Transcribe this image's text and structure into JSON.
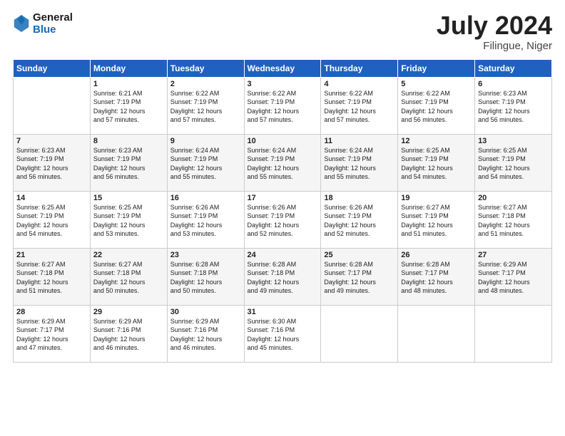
{
  "header": {
    "logo_line1": "General",
    "logo_line2": "Blue",
    "month_title": "July 2024",
    "location": "Filingue, Niger"
  },
  "days_of_week": [
    "Sunday",
    "Monday",
    "Tuesday",
    "Wednesday",
    "Thursday",
    "Friday",
    "Saturday"
  ],
  "weeks": [
    [
      {
        "day": "",
        "info": ""
      },
      {
        "day": "1",
        "info": "Sunrise: 6:21 AM\nSunset: 7:19 PM\nDaylight: 12 hours\nand 57 minutes."
      },
      {
        "day": "2",
        "info": "Sunrise: 6:22 AM\nSunset: 7:19 PM\nDaylight: 12 hours\nand 57 minutes."
      },
      {
        "day": "3",
        "info": "Sunrise: 6:22 AM\nSunset: 7:19 PM\nDaylight: 12 hours\nand 57 minutes."
      },
      {
        "day": "4",
        "info": "Sunrise: 6:22 AM\nSunset: 7:19 PM\nDaylight: 12 hours\nand 57 minutes."
      },
      {
        "day": "5",
        "info": "Sunrise: 6:22 AM\nSunset: 7:19 PM\nDaylight: 12 hours\nand 56 minutes."
      },
      {
        "day": "6",
        "info": "Sunrise: 6:23 AM\nSunset: 7:19 PM\nDaylight: 12 hours\nand 56 minutes."
      }
    ],
    [
      {
        "day": "7",
        "info": "Sunrise: 6:23 AM\nSunset: 7:19 PM\nDaylight: 12 hours\nand 56 minutes."
      },
      {
        "day": "8",
        "info": "Sunrise: 6:23 AM\nSunset: 7:19 PM\nDaylight: 12 hours\nand 56 minutes."
      },
      {
        "day": "9",
        "info": "Sunrise: 6:24 AM\nSunset: 7:19 PM\nDaylight: 12 hours\nand 55 minutes."
      },
      {
        "day": "10",
        "info": "Sunrise: 6:24 AM\nSunset: 7:19 PM\nDaylight: 12 hours\nand 55 minutes."
      },
      {
        "day": "11",
        "info": "Sunrise: 6:24 AM\nSunset: 7:19 PM\nDaylight: 12 hours\nand 55 minutes."
      },
      {
        "day": "12",
        "info": "Sunrise: 6:25 AM\nSunset: 7:19 PM\nDaylight: 12 hours\nand 54 minutes."
      },
      {
        "day": "13",
        "info": "Sunrise: 6:25 AM\nSunset: 7:19 PM\nDaylight: 12 hours\nand 54 minutes."
      }
    ],
    [
      {
        "day": "14",
        "info": "Sunrise: 6:25 AM\nSunset: 7:19 PM\nDaylight: 12 hours\nand 54 minutes."
      },
      {
        "day": "15",
        "info": "Sunrise: 6:25 AM\nSunset: 7:19 PM\nDaylight: 12 hours\nand 53 minutes."
      },
      {
        "day": "16",
        "info": "Sunrise: 6:26 AM\nSunset: 7:19 PM\nDaylight: 12 hours\nand 53 minutes."
      },
      {
        "day": "17",
        "info": "Sunrise: 6:26 AM\nSunset: 7:19 PM\nDaylight: 12 hours\nand 52 minutes."
      },
      {
        "day": "18",
        "info": "Sunrise: 6:26 AM\nSunset: 7:19 PM\nDaylight: 12 hours\nand 52 minutes."
      },
      {
        "day": "19",
        "info": "Sunrise: 6:27 AM\nSunset: 7:19 PM\nDaylight: 12 hours\nand 51 minutes."
      },
      {
        "day": "20",
        "info": "Sunrise: 6:27 AM\nSunset: 7:18 PM\nDaylight: 12 hours\nand 51 minutes."
      }
    ],
    [
      {
        "day": "21",
        "info": "Sunrise: 6:27 AM\nSunset: 7:18 PM\nDaylight: 12 hours\nand 51 minutes."
      },
      {
        "day": "22",
        "info": "Sunrise: 6:27 AM\nSunset: 7:18 PM\nDaylight: 12 hours\nand 50 minutes."
      },
      {
        "day": "23",
        "info": "Sunrise: 6:28 AM\nSunset: 7:18 PM\nDaylight: 12 hours\nand 50 minutes."
      },
      {
        "day": "24",
        "info": "Sunrise: 6:28 AM\nSunset: 7:18 PM\nDaylight: 12 hours\nand 49 minutes."
      },
      {
        "day": "25",
        "info": "Sunrise: 6:28 AM\nSunset: 7:17 PM\nDaylight: 12 hours\nand 49 minutes."
      },
      {
        "day": "26",
        "info": "Sunrise: 6:28 AM\nSunset: 7:17 PM\nDaylight: 12 hours\nand 48 minutes."
      },
      {
        "day": "27",
        "info": "Sunrise: 6:29 AM\nSunset: 7:17 PM\nDaylight: 12 hours\nand 48 minutes."
      }
    ],
    [
      {
        "day": "28",
        "info": "Sunrise: 6:29 AM\nSunset: 7:17 PM\nDaylight: 12 hours\nand 47 minutes."
      },
      {
        "day": "29",
        "info": "Sunrise: 6:29 AM\nSunset: 7:16 PM\nDaylight: 12 hours\nand 46 minutes."
      },
      {
        "day": "30",
        "info": "Sunrise: 6:29 AM\nSunset: 7:16 PM\nDaylight: 12 hours\nand 46 minutes."
      },
      {
        "day": "31",
        "info": "Sunrise: 6:30 AM\nSunset: 7:16 PM\nDaylight: 12 hours\nand 45 minutes."
      },
      {
        "day": "",
        "info": ""
      },
      {
        "day": "",
        "info": ""
      },
      {
        "day": "",
        "info": ""
      }
    ]
  ]
}
